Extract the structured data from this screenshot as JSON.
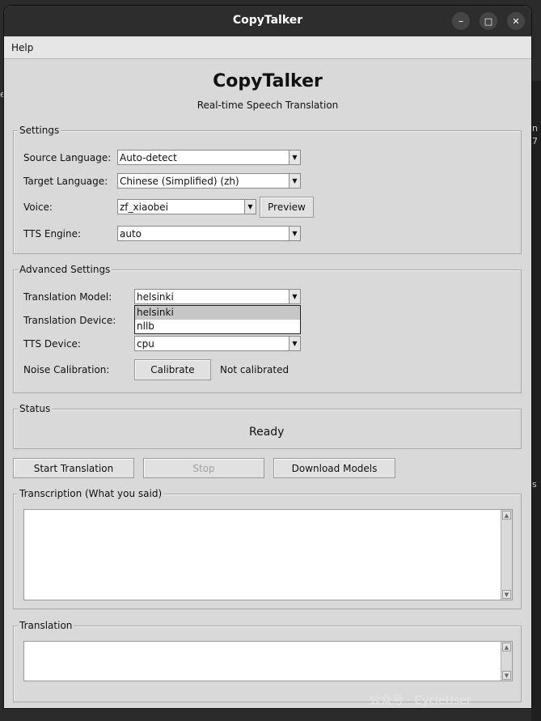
{
  "window": {
    "title": "CopyTalker",
    "controls": {
      "minimize": "–",
      "maximize": "□",
      "close": "✕"
    }
  },
  "menubar": {
    "help": "Help"
  },
  "header": {
    "title": "CopyTalker",
    "subtitle": "Real-time Speech Translation"
  },
  "settings": {
    "group_label": "Settings",
    "source_language": {
      "label": "Source Language:",
      "value": "Auto-detect"
    },
    "target_language": {
      "label": "Target Language:",
      "value": "Chinese (Simplified) (zh)"
    },
    "voice": {
      "label": "Voice:",
      "value": "zf_xiaobei",
      "preview": "Preview"
    },
    "tts_engine": {
      "label": "TTS Engine:",
      "value": "auto"
    }
  },
  "advanced": {
    "group_label": "Advanced Settings",
    "translation_model": {
      "label": "Translation Model:",
      "value": "helsinki",
      "options": [
        "helsinki",
        "nllb"
      ]
    },
    "translation_device": {
      "label": "Translation Device:"
    },
    "tts_device": {
      "label": "TTS Device:",
      "value": "cpu"
    },
    "noise_calibration": {
      "label": "Noise Calibration:",
      "button": "Calibrate",
      "status": "Not calibrated"
    }
  },
  "status": {
    "group_label": "Status",
    "text": "Ready"
  },
  "actions": {
    "start": "Start Translation",
    "stop": "Stop",
    "download": "Download Models"
  },
  "transcription": {
    "group_label": "Transcription (What you said)"
  },
  "translation": {
    "group_label": "Translation"
  },
  "background": {
    "frag1": "n",
    "frag2": "7",
    "frag3": "s",
    "frag4": "e"
  },
  "watermark": "公众号 · CycleUser"
}
